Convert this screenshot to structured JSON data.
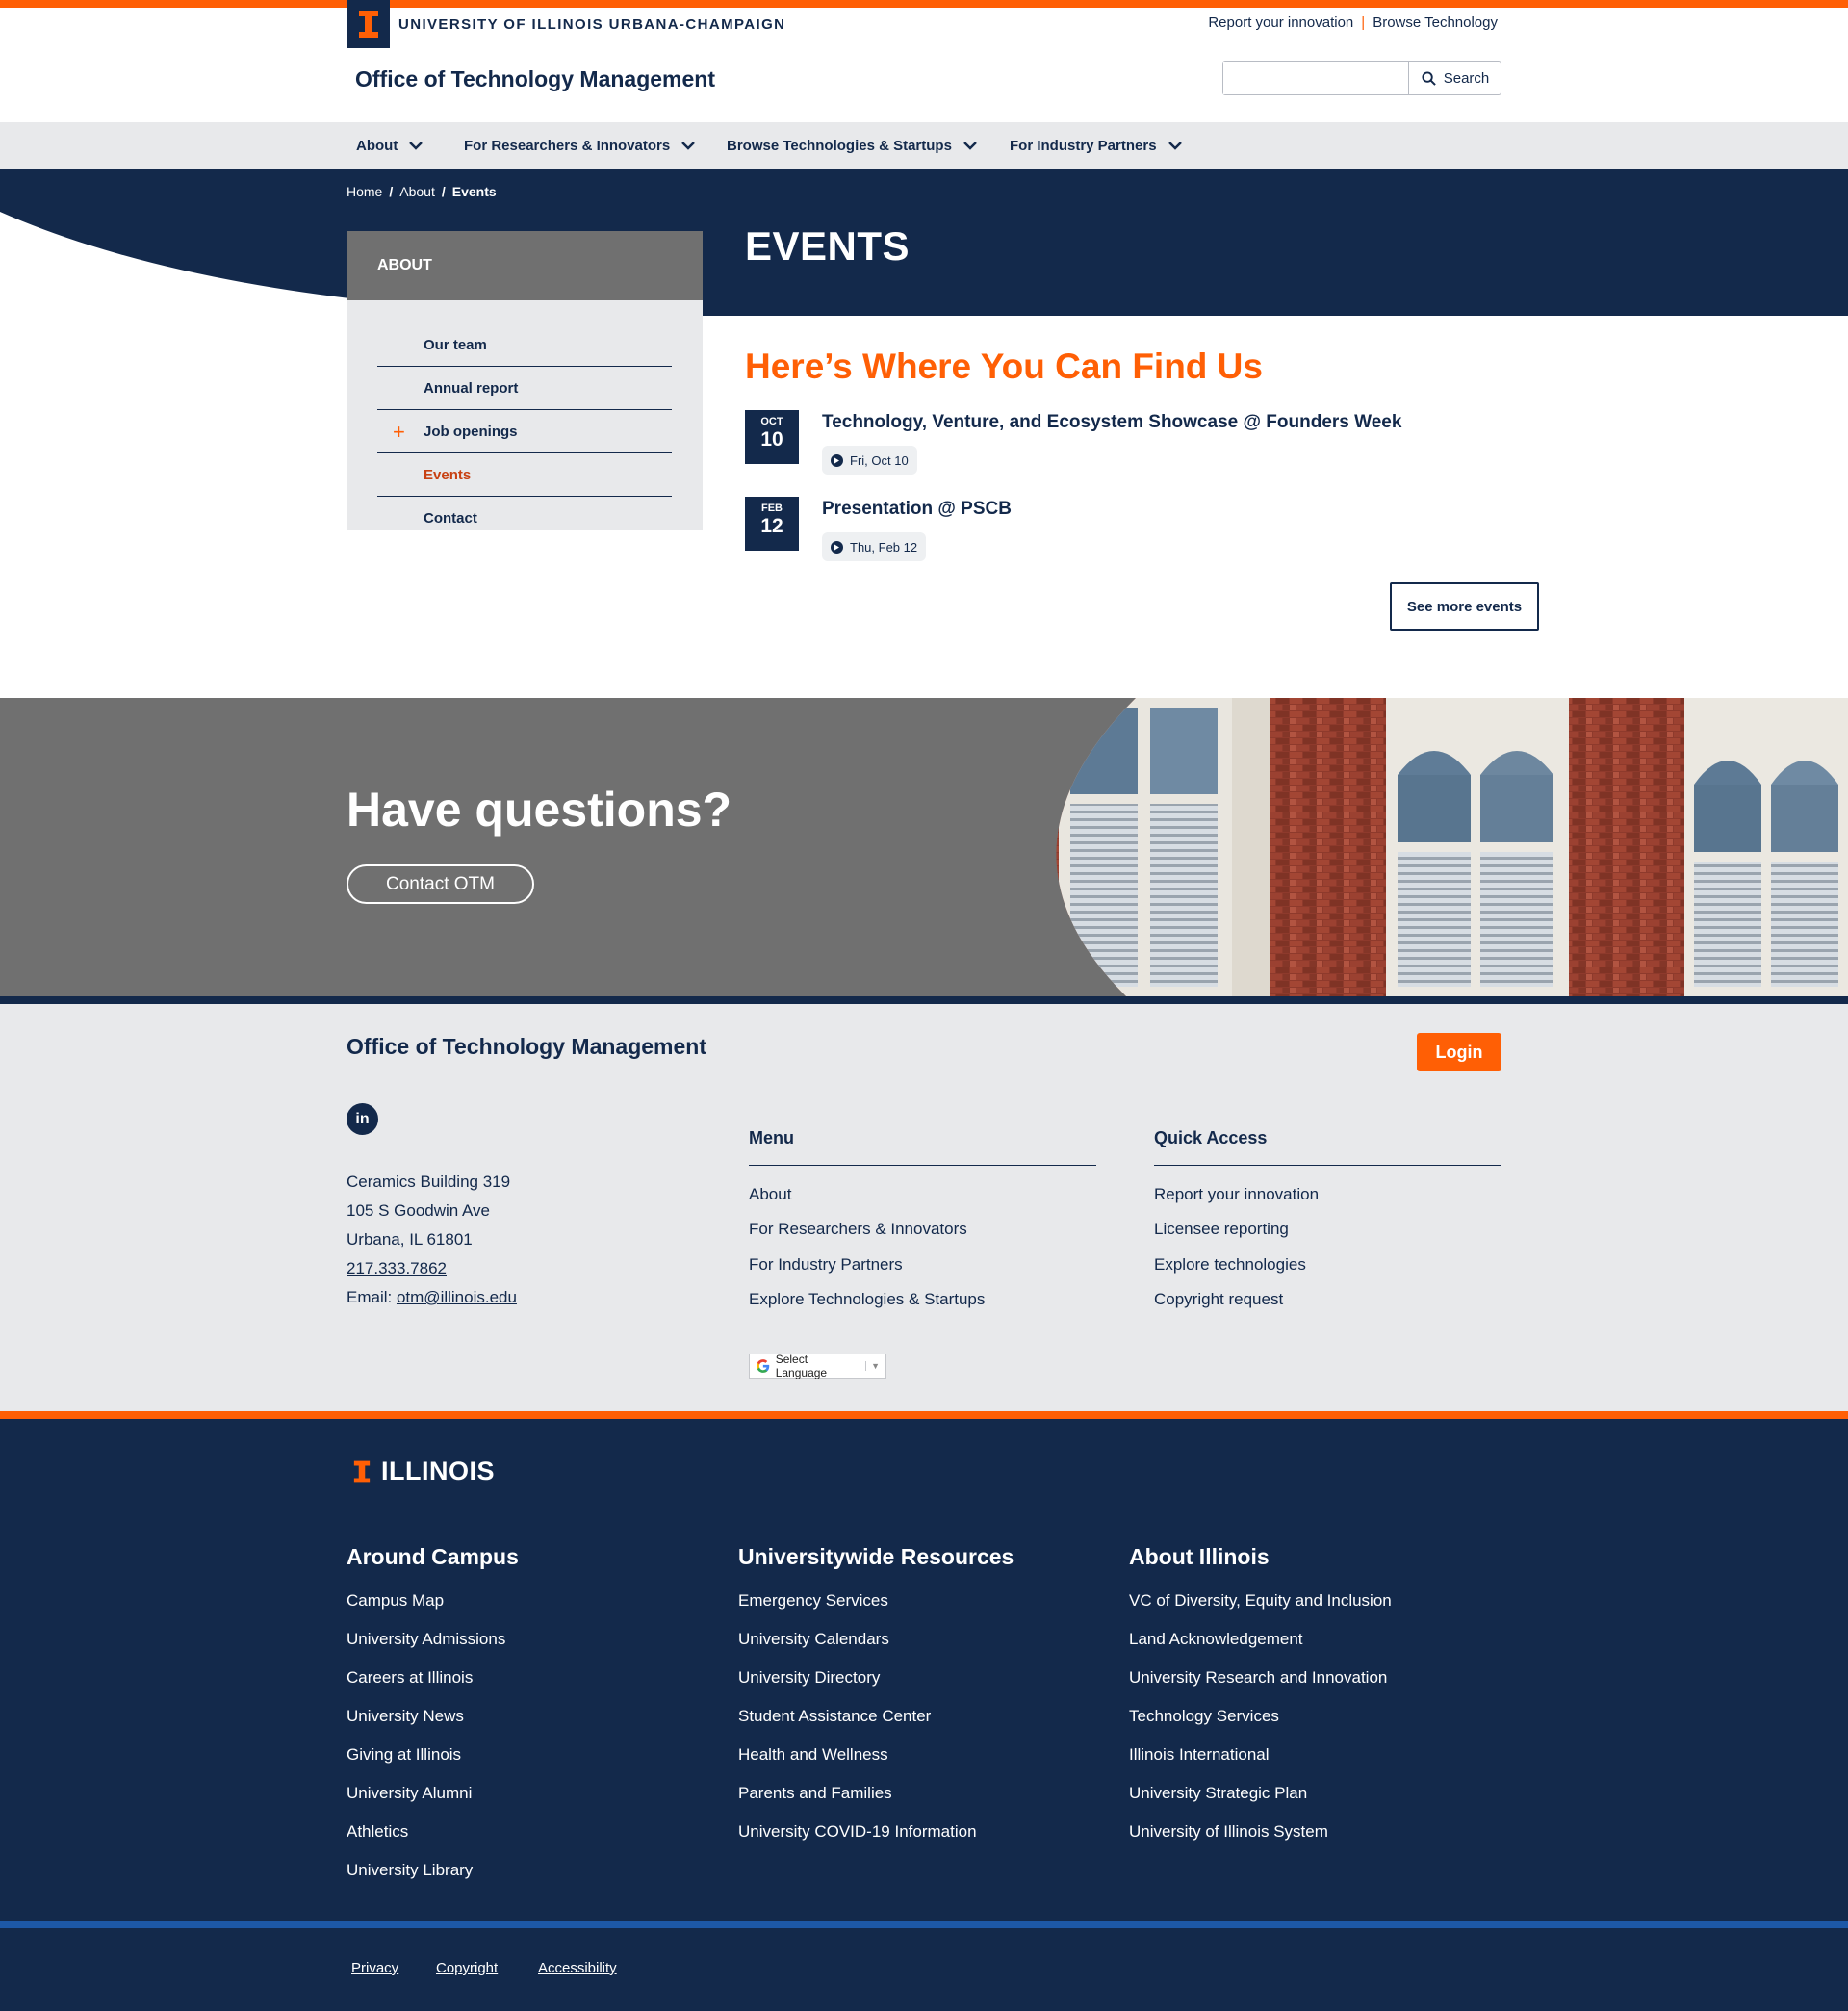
{
  "brand": {
    "wordmark": "UNIVERSITY OF ILLINOIS URBANA-CHAMPAIGN",
    "site_title": "Office of Technology Management",
    "orange": "#ff5f05",
    "navy": "#13294b",
    "gray": "#707070"
  },
  "utility": {
    "report": "Report your innovation",
    "separator": "|",
    "browse": "Browse Technology"
  },
  "search": {
    "value": "",
    "placeholder": "",
    "button": "Search"
  },
  "nav": [
    {
      "label": "About"
    },
    {
      "label": "For Researchers & Innovators"
    },
    {
      "label": "Browse Technologies & Startups"
    },
    {
      "label": "For Industry Partners"
    }
  ],
  "breadcrumb": {
    "home": "Home",
    "sep": "/",
    "about": "About",
    "current": "Events"
  },
  "page_title": "EVENTS",
  "sidebar": {
    "heading": "ABOUT",
    "items": [
      {
        "label": "Our team"
      },
      {
        "label": "Annual report"
      },
      {
        "label": "Job openings",
        "expand": "+"
      },
      {
        "label": "Events"
      },
      {
        "label": "Contact"
      }
    ]
  },
  "events": {
    "heading": "Here’s Where You Can Find Us",
    "list": [
      {
        "month": "OCT",
        "day": "10",
        "title": "Technology, Venture, and Ecosystem Showcase @ Founders Week",
        "date": "Fri, Oct 10"
      },
      {
        "month": "FEB",
        "day": "12",
        "title": "Presentation @ PSCB",
        "date": "Thu, Feb 12"
      }
    ],
    "more": "See more events"
  },
  "questions": {
    "title": "Have questions?",
    "button": "Contact OTM"
  },
  "footer": {
    "title": "Office of Technology Management",
    "login": "Login",
    "linkedin": "in",
    "address": {
      "line1": "Ceramics Building 319",
      "line2": "105 S Goodwin Ave",
      "line3": "Urbana, IL 61801",
      "phone": "217.333.7862",
      "email_label": "Email:",
      "email": "otm@illinois.edu"
    },
    "menu": {
      "heading": "Menu",
      "links": [
        "About",
        "For Researchers & Innovators",
        "For Industry Partners",
        "Explore Technologies & Startups"
      ]
    },
    "quick": {
      "heading": "Quick Access",
      "links": [
        "Report your innovation",
        "Licensee reporting",
        "Explore technologies",
        "Copyright request"
      ]
    },
    "language": {
      "label": "Select Language",
      "arrow": "▼"
    }
  },
  "dark_footer": {
    "logo_text": "ILLINOIS",
    "columns": [
      {
        "heading": "Around Campus",
        "links": [
          "Campus Map",
          "University Admissions",
          "Careers at Illinois",
          "University News",
          "Giving at Illinois",
          "University Alumni",
          "Athletics",
          "University Library"
        ]
      },
      {
        "heading": "Universitywide Resources",
        "links": [
          "Emergency Services",
          "University Calendars",
          "University Directory",
          "Student Assistance Center",
          "Health and Wellness",
          "Parents and Families",
          "University COVID-19 Information"
        ]
      },
      {
        "heading": "About Illinois",
        "links": [
          "VC of Diversity, Equity and Inclusion",
          "Land Acknowledgement",
          "University Research and Innovation",
          "Technology Services",
          "Illinois International",
          "University Strategic Plan",
          "University of Illinois System"
        ]
      }
    ],
    "legal": [
      "Privacy",
      "Copyright",
      "Accessibility"
    ]
  }
}
